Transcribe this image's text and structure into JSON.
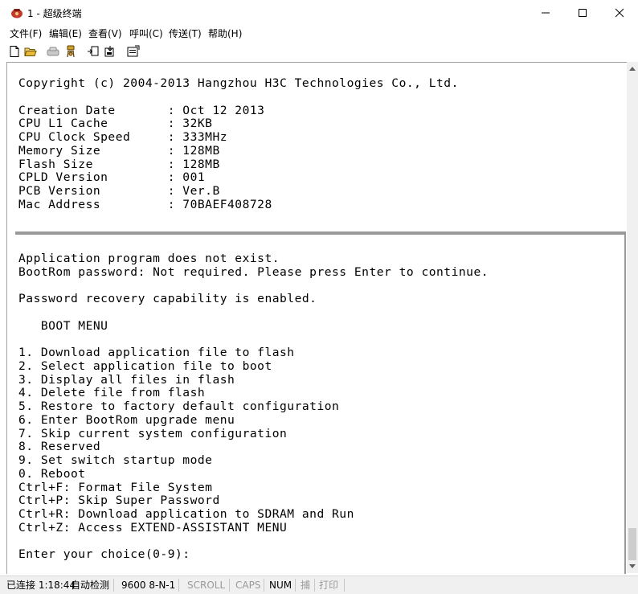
{
  "window": {
    "title": "1 - 超级终端"
  },
  "menu": {
    "items": [
      "文件(F)",
      "编辑(E)",
      "查看(V)",
      "呼叫(C)",
      "传送(T)",
      "帮助(H)"
    ]
  },
  "terminal": {
    "text": "Copyright (c) 2004-2013 Hangzhou H3C Technologies Co., Ltd.\n\nCreation Date       : Oct 12 2013\nCPU L1 Cache        : 32KB\nCPU Clock Speed     : 333MHz\nMemory Size         : 128MB\nFlash Size          : 128MB\nCPLD Version        : 001\nPCB Version         : Ver.B\nMac Address         : 70BAEF408728\n\n\n\nApplication program does not exist.\nBootRom password: Not required. Please press Enter to continue.\n\nPassword recovery capability is enabled.\n\n   BOOT MENU\n\n1. Download application file to flash\n2. Select application file to boot\n3. Display all files in flash\n4. Delete file from flash\n5. Restore to factory default configuration\n6. Enter BootRom upgrade menu\n7. Skip current system configuration\n8. Reserved\n9. Set switch startup mode\n0. Reboot\nCtrl+F: Format File System\nCtrl+P: Skip Super Password\nCtrl+R: Download application to SDRAM and Run\nCtrl+Z: Access EXTEND-ASSISTANT MENU\n\nEnter your choice(0-9):"
  },
  "status": {
    "connection": "已连接 1:18:44",
    "detect": "自动检测",
    "settings": "9600 8-N-1",
    "scroll": "SCROLL",
    "caps": "CAPS",
    "num": "NUM",
    "capture": "捕",
    "print": "打印"
  }
}
